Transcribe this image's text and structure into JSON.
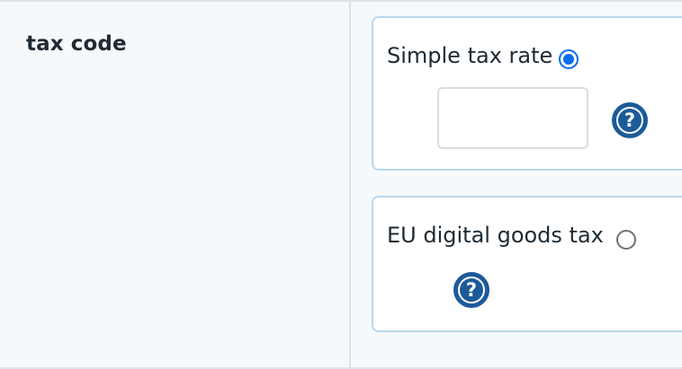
{
  "field": {
    "label": "tax code"
  },
  "options": {
    "simple": {
      "label": "Simple tax rate",
      "selected": true,
      "input_value": "",
      "help_icon": "question-circle-icon"
    },
    "eu": {
      "label": "EU digital goods tax",
      "selected": false,
      "help_icon": "question-circle-icon"
    }
  },
  "colors": {
    "accent": "#0a6cf0",
    "help_icon": "#1d5a9a",
    "panel_border": "#b8d7ef",
    "page_background": "#f5f9fc"
  }
}
